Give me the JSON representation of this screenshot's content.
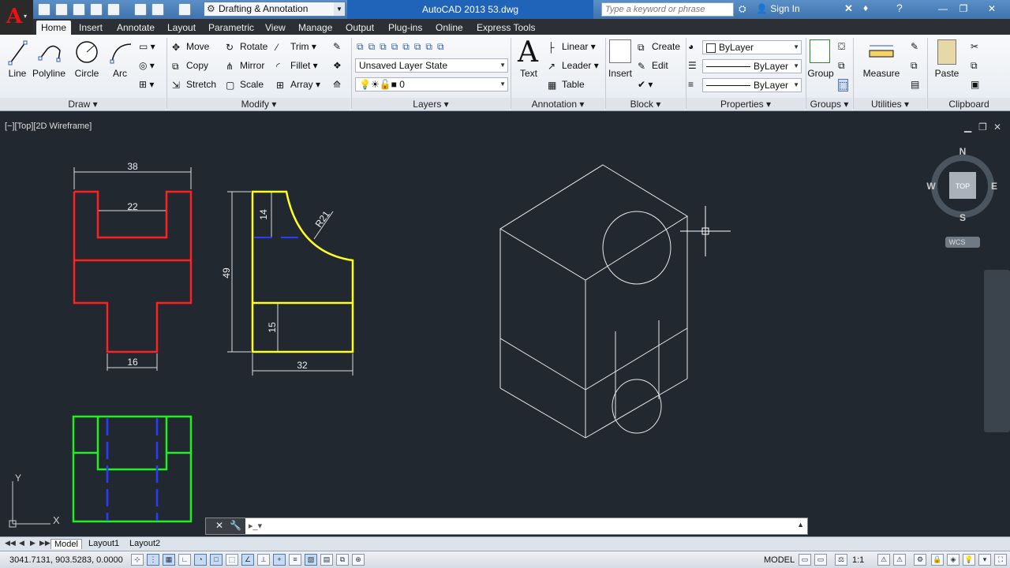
{
  "titlebar": {
    "workspace": "Drafting & Annotation",
    "doc_title": "AutoCAD 2013    53.dwg",
    "search_placeholder": "Type a keyword or phrase",
    "sign_in": "Sign In"
  },
  "tabs": [
    "Home",
    "Insert",
    "Annotate",
    "Layout",
    "Parametric",
    "View",
    "Manage",
    "Output",
    "Plug-ins",
    "Online",
    "Express Tools"
  ],
  "ribbon": {
    "draw": {
      "title": "Draw",
      "line": "Line",
      "polyline": "Polyline",
      "circle": "Circle",
      "arc": "Arc"
    },
    "modify": {
      "title": "Modify",
      "move": "Move",
      "rotate": "Rotate",
      "trim": "Trim",
      "copy": "Copy",
      "mirror": "Mirror",
      "fillet": "Fillet",
      "stretch": "Stretch",
      "scale": "Scale",
      "array": "Array"
    },
    "layers": {
      "title": "Layers",
      "layer_state": "Unsaved Layer State",
      "current_layer": "0"
    },
    "annotation": {
      "title": "Annotation",
      "text": "Text",
      "linear": "Linear",
      "leader": "Leader",
      "table": "Table"
    },
    "block": {
      "title": "Block",
      "insert": "Insert",
      "create": "Create",
      "edit": "Edit"
    },
    "properties": {
      "title": "Properties",
      "color": "ByLayer",
      "linetype": "ByLayer",
      "lineweight": "ByLayer"
    },
    "groups": {
      "title": "Groups",
      "group": "Group"
    },
    "utilities": {
      "title": "Utilities",
      "measure": "Measure"
    },
    "clipboard": {
      "title": "Clipboard",
      "paste": "Paste"
    }
  },
  "viewport": {
    "label": "[−][Top][2D Wireframe]",
    "dims": {
      "d38": "38",
      "d22": "22",
      "d16": "16",
      "d49": "49",
      "d14": "14",
      "d15": "15",
      "d32": "32",
      "r21": "R21"
    },
    "viewcube": {
      "top": "TOP",
      "n": "N",
      "s": "S",
      "e": "E",
      "w": "W",
      "wcs": "WCS"
    },
    "ucs": {
      "x": "X",
      "y": "Y"
    }
  },
  "cmdline": {
    "placeholder": ""
  },
  "layout_tabs": [
    "Model",
    "Layout1",
    "Layout2"
  ],
  "status": {
    "coords": "3041.7131, 903.5283, 0.0000",
    "model": "MODEL",
    "scale": "1:1"
  },
  "colors": {
    "red": "#ff2020",
    "yellow": "#ffff22",
    "green": "#22ee22",
    "blue": "#2a3cff",
    "white": "#e8e8e8",
    "viewport_bg": "#212830"
  }
}
